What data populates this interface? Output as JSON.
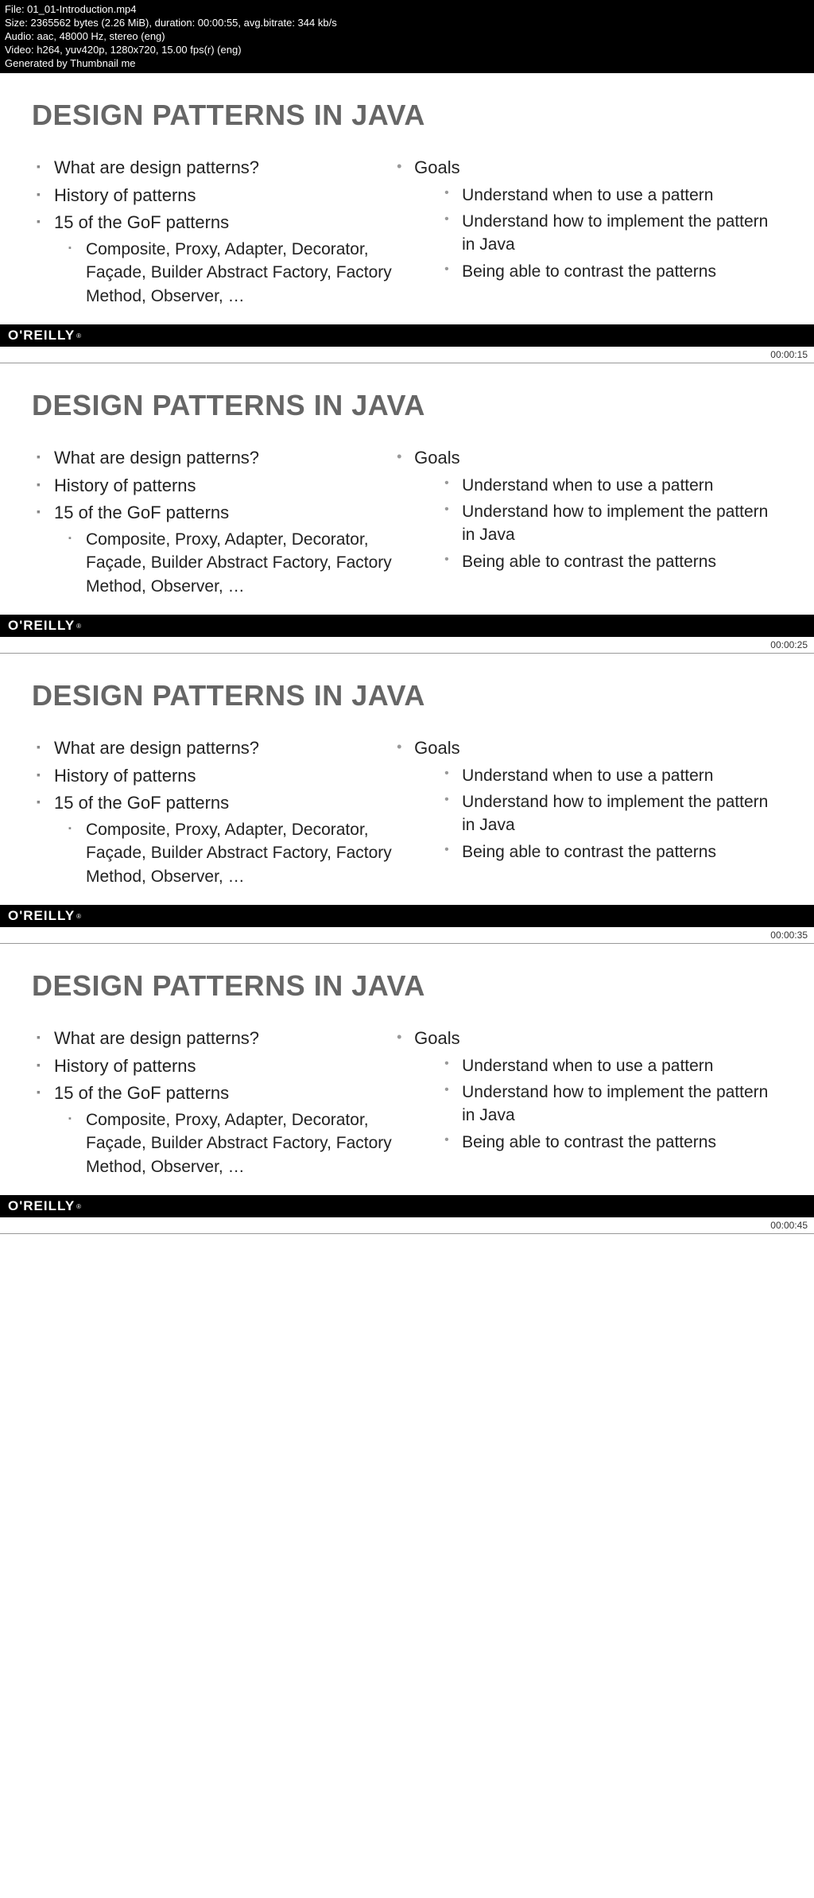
{
  "meta": {
    "file": "File: 01_01-Introduction.mp4",
    "size": "Size: 2365562 bytes (2.26 MiB), duration: 00:00:55, avg.bitrate: 344 kb/s",
    "audio": "Audio: aac, 48000 Hz, stereo (eng)",
    "video": "Video: h264, yuv420p, 1280x720, 15.00 fps(r) (eng)",
    "generated": "Generated by Thumbnail me"
  },
  "slide": {
    "title": "DESIGN PATTERNS IN JAVA",
    "left": {
      "i1": "What are design patterns?",
      "i2": "History of patterns",
      "i3": "15 of the GoF patterns",
      "sub": "Composite, Proxy, Adapter, Decorator, Façade, Builder Abstract Factory, Factory Method, Observer, …"
    },
    "right": {
      "head": "Goals",
      "g1": "Understand when to use a pattern",
      "g2": "Understand how to implement the pattern in Java",
      "g3": "Being able to contrast the patterns"
    },
    "brand": "O'REILLY",
    "rmark": "®"
  },
  "timestamps": {
    "t1": "00:00:15",
    "t2": "00:00:25",
    "t3": "00:00:35",
    "t4": "00:00:45"
  }
}
